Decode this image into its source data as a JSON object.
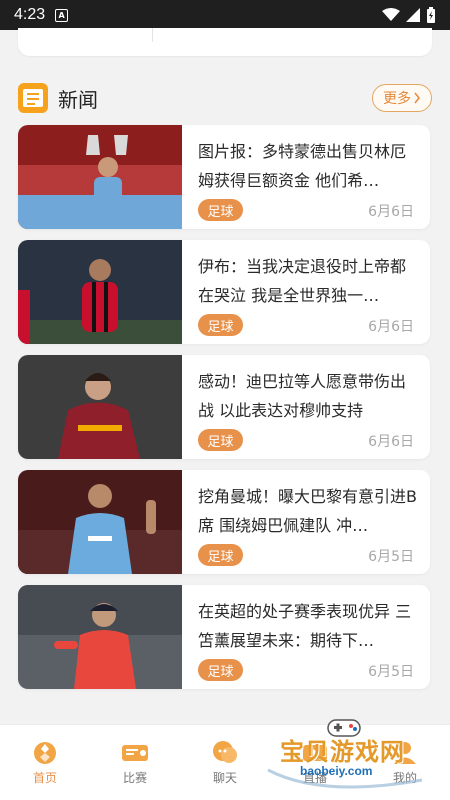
{
  "status_bar": {
    "time": "4:23",
    "notification_icon": "A"
  },
  "news": {
    "title": "新闻",
    "more_label": "更多"
  },
  "items": [
    {
      "title": "图片报：多特蒙德出售贝林厄姆获得巨额资金 他们希…",
      "tag": "足球",
      "date": "6月6日",
      "thumb_colors": [
        "#8d1e1e",
        "#6fa7d9",
        "#d9d9d9"
      ]
    },
    {
      "title": "伊布：当我决定退役时上帝都在哭泣 我是全世界独一…",
      "tag": "足球",
      "date": "6月6日",
      "thumb_colors": [
        "#2a3342",
        "#c8102e",
        "#111111"
      ]
    },
    {
      "title": "感动！迪巴拉等人愿意带伤出战 以此表达对穆帅支持",
      "tag": "足球",
      "date": "6月6日",
      "thumb_colors": [
        "#3d3d3d",
        "#8e1f2b",
        "#f2a900"
      ]
    },
    {
      "title": "挖角曼城！曝大巴黎有意引进B席 围绕姆巴佩建队 冲…",
      "tag": "足球",
      "date": "6月5日",
      "thumb_colors": [
        "#4a1b1b",
        "#6cabdd",
        "#ffffff"
      ]
    },
    {
      "title": "在英超的处子赛季表现优异 三笘薰展望未来：期待下…",
      "tag": "足球",
      "date": "6月5日",
      "thumb_colors": [
        "#5b5f66",
        "#e8473d",
        "#1b1f2e"
      ]
    }
  ],
  "bottom_nav": [
    {
      "label": "首页",
      "icon": "home-ball-icon",
      "active": true
    },
    {
      "label": "比赛",
      "icon": "match-ticket-icon",
      "active": false
    },
    {
      "label": "聊天",
      "icon": "chat-bubble-icon",
      "active": false
    },
    {
      "label": "直播",
      "icon": "live-tv-icon",
      "active": false
    },
    {
      "label": "我的",
      "icon": "profile-icon",
      "active": false
    }
  ],
  "watermark": {
    "text": "宝贝游戏网",
    "url": "baobeiy.com"
  },
  "colors": {
    "accent": "#e8914a",
    "news_icon": "#f6a21d"
  }
}
